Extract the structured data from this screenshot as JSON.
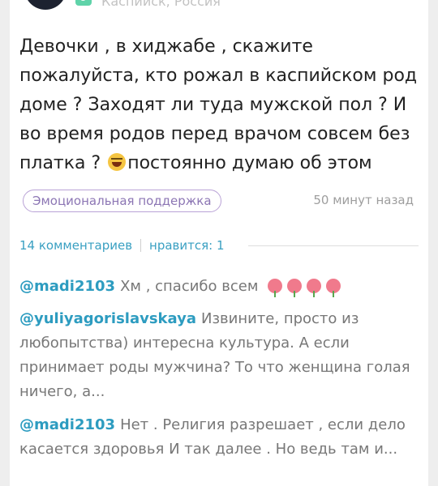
{
  "author": {
    "badge": "5",
    "location": "Каспийск, Россия"
  },
  "post": {
    "text_before_emoji": "Девочки , в хиджабе , скажите пожалуйста, кто рожал в каспийском род доме ? Заходят ли туда мужской пол ? И во время родов перед врачом совсем без платка ?",
    "emoji": "face-with-tears-of-joy",
    "text_after_emoji": "постоянно думаю об этом",
    "tag": "Эмоциональная поддержка",
    "time": "50 минут назад"
  },
  "stats": {
    "comments": "14 комментариев",
    "likes": "нравится: 1"
  },
  "comments": [
    {
      "user": "@madi2103",
      "text": "Хм , спасибо всем",
      "emojis": [
        "rose-icon",
        "rose-icon",
        "rose-icon",
        "rose-icon"
      ]
    },
    {
      "user": "@yuliyagorislavskaya",
      "text": "Извините, просто из любопытства) интересна культура. А если принимает роды мужчина? То что женщина голая ничего, а..."
    },
    {
      "user": "@madi2103",
      "text": "Нет . Религия разрешает , если дело касается здоровья И так далее . Но ведь там и..."
    }
  ],
  "colors": {
    "username": "#2d9cc0",
    "stats": "#3aa0c2",
    "tag_border": "#b9a2d6",
    "tag_text": "#8c76b4",
    "badge": "#5fd3a9"
  }
}
